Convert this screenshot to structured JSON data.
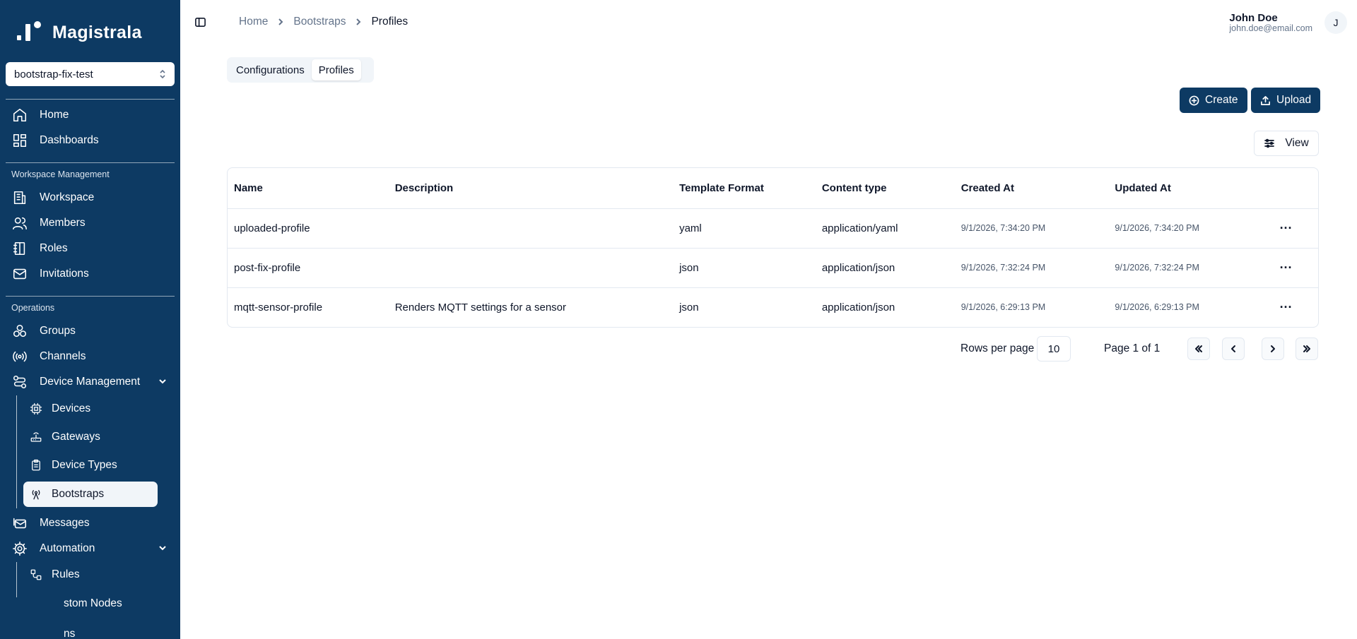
{
  "app": {
    "brand": "Magistrala"
  },
  "sidebar": {
    "workspace_select": "bootstrap-fix-test",
    "top_items": [
      {
        "label": "Home",
        "icon": "home-icon"
      },
      {
        "label": "Dashboards",
        "icon": "dashboard-icon"
      }
    ],
    "workspace_section": "Workspace Management",
    "workspace_items": [
      {
        "label": "Workspace",
        "icon": "building-icon"
      },
      {
        "label": "Members",
        "icon": "users-icon"
      },
      {
        "label": "Roles",
        "icon": "notebook-icon"
      },
      {
        "label": "Invitations",
        "icon": "mail-icon"
      }
    ],
    "operations_section": "Operations",
    "operations_items": [
      {
        "label": "Groups",
        "icon": "groups-icon"
      },
      {
        "label": "Channels",
        "icon": "radio-icon"
      },
      {
        "label": "Device Management",
        "icon": "workflow-icon"
      }
    ],
    "device_sub": [
      {
        "label": "Devices",
        "icon": "chip-icon"
      },
      {
        "label": "Gateways",
        "icon": "router-icon"
      },
      {
        "label": "Device Types",
        "icon": "clipboard-icon"
      },
      {
        "label": "Bootstraps",
        "icon": "antenna-icon"
      }
    ],
    "messages": "Messages",
    "automation": "Automation",
    "automation_sub": [
      {
        "label": "Rules",
        "icon": "rules-icon"
      },
      {
        "label": "stom Nodes"
      },
      {
        "label": "ns"
      }
    ]
  },
  "breadcrumb": [
    "Home",
    "Bootstraps",
    "Profiles"
  ],
  "user": {
    "name": "John Doe",
    "email": "john.doe@email.com",
    "initial": "J"
  },
  "tabs": [
    "Configurations",
    "Profiles"
  ],
  "actions": {
    "create": "Create",
    "upload": "Upload",
    "view": "View"
  },
  "table": {
    "columns": [
      "Name",
      "Description",
      "Template Format",
      "Content type",
      "Created At",
      "Updated At"
    ],
    "rows": [
      {
        "name": "uploaded-profile",
        "description": "",
        "format": "yaml",
        "content_type": "application/yaml",
        "created": "9/1/2026, 7:34:20 PM",
        "updated": "9/1/2026, 7:34:20 PM"
      },
      {
        "name": "post-fix-profile",
        "description": "",
        "format": "json",
        "content_type": "application/json",
        "created": "9/1/2026, 7:32:24 PM",
        "updated": "9/1/2026, 7:32:24 PM"
      },
      {
        "name": "mqtt-sensor-profile",
        "description": "Renders MQTT settings for a sensor",
        "format": "json",
        "content_type": "application/json",
        "created": "9/1/2026, 6:29:13 PM",
        "updated": "9/1/2026, 6:29:13 PM"
      }
    ],
    "row_menu": "···"
  },
  "pagination": {
    "rows_label": "Rows per page",
    "rows_value": "10",
    "page_text": "Page 1 of 1"
  },
  "colors": {
    "sidebar": "#0d3a63",
    "primary": "#0d3a63"
  }
}
